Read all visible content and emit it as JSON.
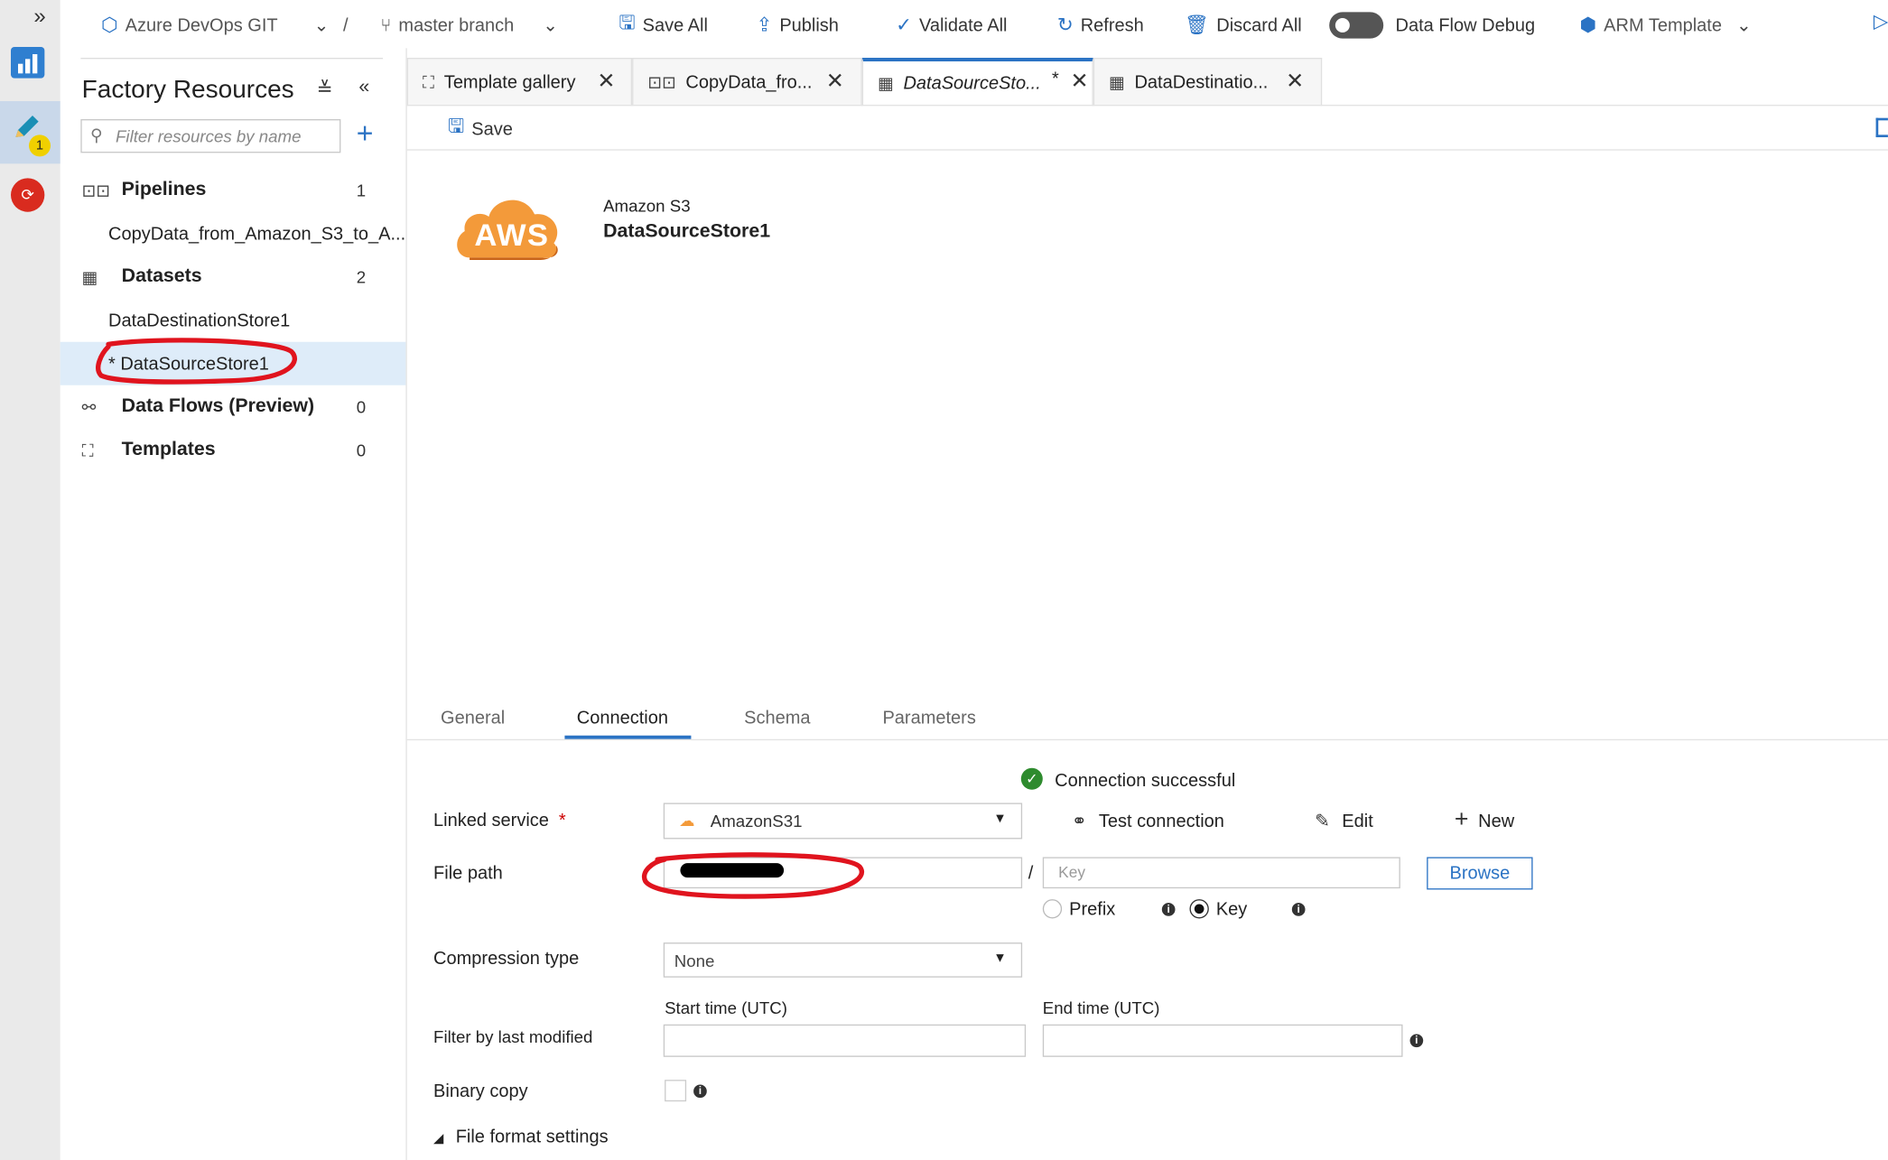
{
  "toolbar": {
    "repo": "Azure DevOps GIT",
    "separator": "/",
    "branch": "master branch",
    "save_all": "Save All",
    "publish": "Publish",
    "validate_all": "Validate All",
    "refresh": "Refresh",
    "discard_all": "Discard All",
    "data_flow_debug": "Data Flow Debug",
    "arm_template": "ARM Template"
  },
  "rail": {
    "expand": "»",
    "author_badge": "1"
  },
  "sidebar": {
    "title": "Factory Resources",
    "filter_placeholder": "Filter resources by name",
    "sections": {
      "pipelines": {
        "label": "Pipelines",
        "count": "1",
        "items": [
          "CopyData_from_Amazon_S3_to_A..."
        ]
      },
      "datasets": {
        "label": "Datasets",
        "count": "2",
        "items": [
          "DataDestinationStore1",
          "* DataSourceStore1"
        ]
      },
      "dataflows": {
        "label": "Data Flows (Preview)",
        "count": "0"
      },
      "templates": {
        "label": "Templates",
        "count": "0"
      }
    }
  },
  "tabs": [
    {
      "label": "Template gallery",
      "icon": "template-icon"
    },
    {
      "label": "CopyData_fro...",
      "icon": "pipeline-icon"
    },
    {
      "label": "DataSourceSto...",
      "dirty": "*",
      "icon": "table-icon"
    },
    {
      "label": "DataDestinatio...",
      "icon": "table-icon"
    }
  ],
  "editor": {
    "save": "Save",
    "dataset_type": "Amazon S3",
    "dataset_name": "DataSourceStore1",
    "logo_text": "AWS"
  },
  "prop_tabs": [
    "General",
    "Connection",
    "Schema",
    "Parameters"
  ],
  "connection": {
    "status": "Connection successful",
    "linked_service_label": "Linked service",
    "required": "*",
    "linked_service_value": "AmazonS31",
    "test_connection": "Test connection",
    "edit": "Edit",
    "new": "New",
    "file_path_label": "File path",
    "slash": "/",
    "key_placeholder": "Key",
    "browse": "Browse",
    "prefix": "Prefix",
    "key": "Key",
    "compression_label": "Compression type",
    "compression_value": "None",
    "start_time": "Start time (UTC)",
    "end_time": "End time (UTC)",
    "filter_label": "Filter by last modified",
    "binary_copy": "Binary copy",
    "file_format": "File format settings"
  },
  "colors": {
    "accent": "#2b73c4",
    "annotation": "#e0141e",
    "aws_orange": "#f39a3a",
    "success": "#2e8b2e"
  }
}
